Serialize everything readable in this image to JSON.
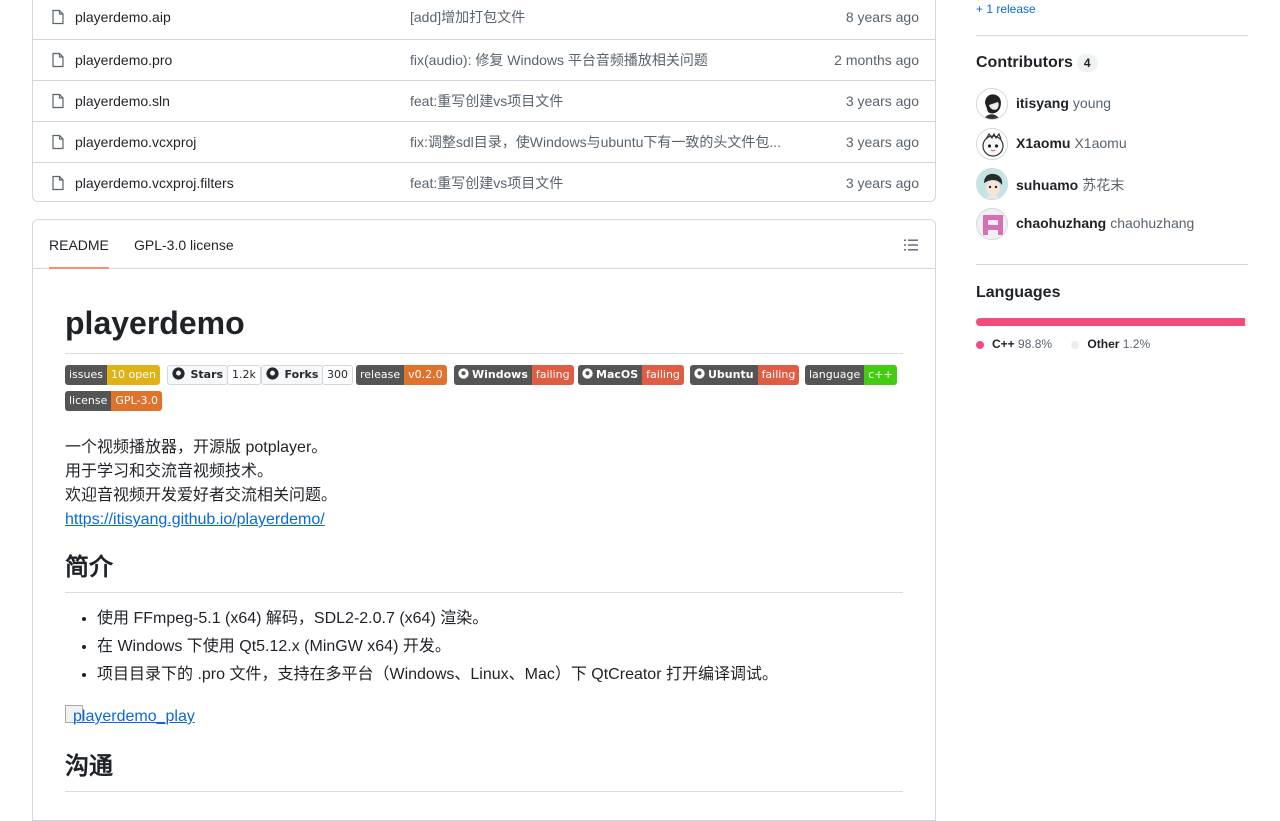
{
  "files": [
    {
      "name": "playerdemo.aip",
      "message": "[add]增加打包文件",
      "time": "8 years ago"
    },
    {
      "name": "playerdemo.pro",
      "message": "fix(audio): 修复 Windows 平台音频播放相关问题",
      "time": "2 months ago"
    },
    {
      "name": "playerdemo.sln",
      "message": "feat:重写创建vs项目文件",
      "time": "3 years ago"
    },
    {
      "name": "playerdemo.vcxproj",
      "message": "fix:调整sdl目录，使Windows与ubuntu下有一致的头文件包...",
      "time": "3 years ago"
    },
    {
      "name": "playerdemo.vcxproj.filters",
      "message": "feat:重写创建vs项目文件",
      "time": "3 years ago"
    }
  ],
  "readme": {
    "tabs": [
      "README",
      "GPL-3.0 license"
    ],
    "title": "playerdemo",
    "badges": [
      {
        "left": "issues",
        "right": "10 open",
        "color": "#dfb317"
      },
      {
        "left": "Stars",
        "right": "1.2k",
        "style": "github"
      },
      {
        "left": "Forks",
        "right": "300",
        "style": "github"
      },
      {
        "left": "release",
        "right": "v0.2.0",
        "color": "#e05d44"
      },
      {
        "left": "Windows",
        "right": "failing",
        "color": "#e05d44",
        "style": "ci"
      },
      {
        "left": "MacOS",
        "right": "failing",
        "color": "#e05d44",
        "style": "ci"
      },
      {
        "left": "Ubuntu",
        "right": "failing",
        "color": "#e05d44",
        "style": "ci"
      },
      {
        "left": "language",
        "right": "c++",
        "color": "#4c1"
      },
      {
        "left": "license",
        "right": "GPL-3.0",
        "color": "#e05d44"
      }
    ],
    "intro_lines": [
      "一个视频播放器，开源版 potplayer。",
      "用于学习和交流音视频技术。",
      "欢迎音视频开发爱好者交流相关问题。"
    ],
    "link": "https://itisyang.github.io/playerdemo/",
    "section1": "简介",
    "features": [
      "使用 FFmpeg-5.1 (x64) 解码，SDL2-2.0.7 (x64) 渲染。",
      "在 Windows 下使用 Qt5.12.x (MinGW x64) 开发。",
      "项目目录下的 .pro 文件，支持在多平台（Windows、Linux、Mac）下 QtCreator 打开编译调试。"
    ],
    "image_alt": "playerdemo_play",
    "section2": "沟通"
  },
  "sidebar": {
    "release_link": "+ 1 release",
    "contributors_title": "Contributors",
    "contributors_count": "4",
    "contributors": [
      {
        "login": "itisyang",
        "name": "young"
      },
      {
        "login": "X1aomu",
        "name": "X1aomu"
      },
      {
        "login": "suhuamo",
        "name": "苏花末"
      },
      {
        "login": "chaohuzhang",
        "name": "chaohuzhang"
      }
    ],
    "languages_title": "Languages",
    "languages": [
      {
        "name": "C++",
        "percent": "98.8%",
        "value": 98.8,
        "color": "#f34b7d"
      },
      {
        "name": "Other",
        "percent": "1.2%",
        "value": 1.2,
        "color": "#ededed"
      }
    ]
  }
}
